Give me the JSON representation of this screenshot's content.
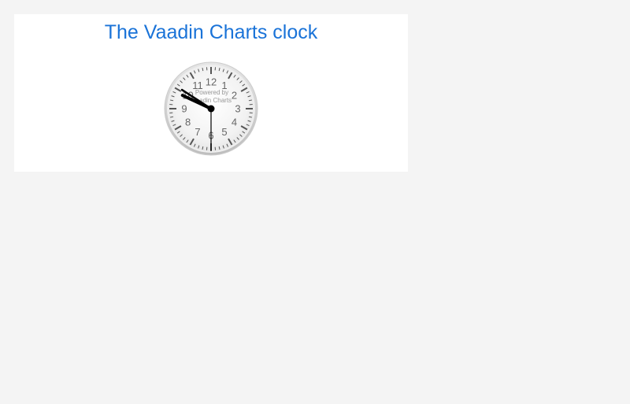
{
  "page": {
    "background": "#f4f4f4",
    "panel_background": "#ffffff"
  },
  "chart_data": {
    "type": "gauge",
    "title": "The Vaadin Charts clock",
    "title_color": "#1a73d8",
    "credit_lines": [
      "Powered by",
      "Vaadin Charts"
    ],
    "dial": {
      "min": 0,
      "max": 12,
      "labels": [
        "12",
        "1",
        "2",
        "3",
        "4",
        "5",
        "6",
        "7",
        "8",
        "9",
        "10",
        "11"
      ],
      "minor_ticks": 60
    },
    "time": {
      "hours": 9,
      "minutes": 50,
      "seconds": 30
    },
    "colors": {
      "hand": "#000000",
      "tick": "#555555",
      "label": "#666666",
      "bezel_outer": "#cccccc",
      "bezel_inner": "#eeeeee"
    }
  }
}
